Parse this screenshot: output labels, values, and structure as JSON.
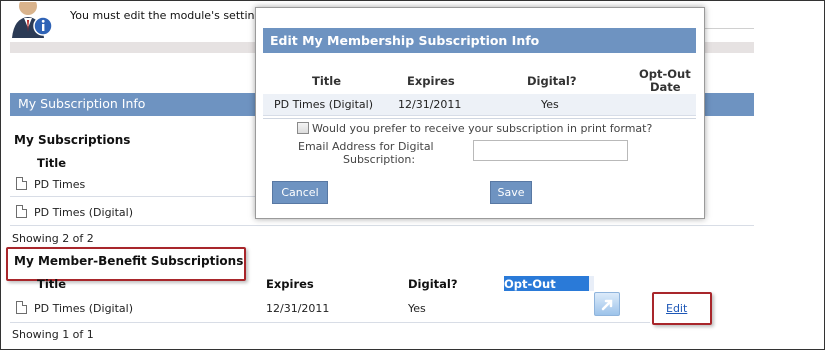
{
  "notice": {
    "text": "You must edit the module's settings first."
  },
  "subscription_bar": {
    "title": "My Subscription Info"
  },
  "my_subscriptions": {
    "title": "My Subscriptions",
    "column_title": "Title",
    "rows": [
      "PD Times",
      "PD Times (Digital)"
    ],
    "showing": "Showing 2 of 2"
  },
  "member_benefit": {
    "title": "My Member-Benefit Subscriptions",
    "columns": {
      "title": "Title",
      "expires": "Expires",
      "digital": "Digital?",
      "optout": "Opt-Out Date"
    },
    "rows": [
      {
        "title": "PD Times (Digital)",
        "expires": "12/31/2011",
        "digital": "Yes",
        "edit": "Edit"
      }
    ],
    "showing": "Showing 1 of 1"
  },
  "modal": {
    "title": "Edit My Membership Subscription Info",
    "columns": {
      "title": "Title",
      "expires": "Expires",
      "digital": "Digital?",
      "optout_line1": "Opt-Out",
      "optout_line2": "Date"
    },
    "row": {
      "title": "PD Times (Digital)",
      "expires": "12/31/2011",
      "digital": "Yes"
    },
    "print_question": "Would you prefer to receive your subscription in print format?",
    "email_label_line1": "Email Address for Digital",
    "email_label_line2": "Subscription:",
    "email_value": "",
    "cancel_label": "Cancel",
    "save_label": "Save"
  },
  "colors": {
    "header_blue": "#6e93c1",
    "highlight_red": "#a8262b",
    "selection_blue": "#2a7ad8",
    "link_blue": "#1d57b7"
  }
}
